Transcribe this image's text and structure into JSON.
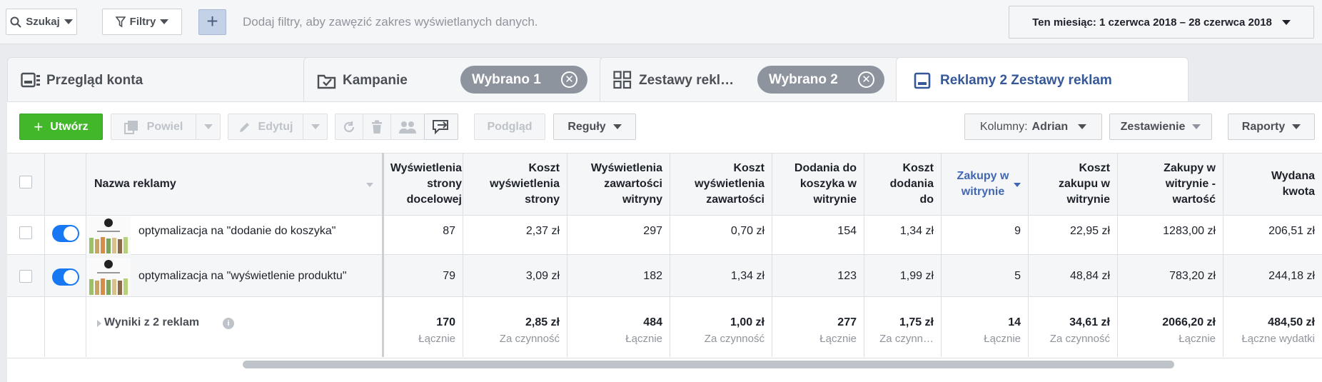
{
  "topbar": {
    "search_label": "Szukaj",
    "filters_label": "Filtry",
    "add_label": "+",
    "filter_hint": "Dodaj filtry, aby zawęzić zakres wyświetlanych danych.",
    "date_range": "Ten miesiąc: 1 czerwca 2018 – 28 czerwca 2018"
  },
  "tabs": [
    {
      "label": "Przegląd konta",
      "icon": "account-overview-icon"
    },
    {
      "label": "Kampanie",
      "icon": "folder-check-icon",
      "pill": "Wybrano 1"
    },
    {
      "label": "Zestawy rekl…",
      "icon": "grid-icon",
      "pill": "Wybrano 2"
    },
    {
      "label": "Reklamy 2 Zestawy reklam",
      "icon": "ad-icon",
      "active": true
    }
  ],
  "toolbar": {
    "create": "Utwórz",
    "duplicate": "Powiel",
    "edit": "Edytuj",
    "preview": "Podgląd",
    "rules": "Reguły",
    "columns_prefix": "Kolumny:",
    "columns_value": "Adrian",
    "breakdown": "Zestawienie",
    "reports": "Raporty"
  },
  "table": {
    "name_header": "Nazwa reklamy",
    "headers": [
      "Wyświetlenia strony docelowej",
      "Koszt wyświetlenia strony",
      "Wyświetlenia zawartości witryny",
      "Koszt wyświetlenia zawartości",
      "Dodania do koszyka w witrynie",
      "Koszt dodania do",
      "Zakupy w witrynie",
      "Koszt zakupu w witrynie",
      "Zakupy w witrynie - wartość",
      "Wydana kwota"
    ],
    "rows": [
      {
        "name": "optymalizacja na \"dodanie do koszyka\"",
        "active": true,
        "values": [
          "87",
          "2,37 zł",
          "297",
          "0,70 zł",
          "154",
          "1,34 zł",
          "9",
          "22,95 zł",
          "1283,00 zł",
          "206,51 zł"
        ]
      },
      {
        "name": "optymalizacja na \"wyświetlenie produktu\"",
        "active": true,
        "values": [
          "79",
          "3,09 zł",
          "182",
          "1,34 zł",
          "123",
          "1,99 zł",
          "5",
          "48,84 zł",
          "783,20 zł",
          "244,18 zł"
        ]
      }
    ],
    "totals": {
      "label": "Wyniki z 2 reklam",
      "values": [
        "170",
        "2,85 zł",
        "484",
        "1,00 zł",
        "277",
        "1,75 zł",
        "14",
        "34,61 zł",
        "2066,20 zł",
        "484,50 zł"
      ],
      "subs": [
        "Łącznie",
        "Za czynność",
        "Łącznie",
        "Za czynność",
        "Łącznie",
        "Za czynn…",
        "Łącznie",
        "Za czynność",
        "Łącznie",
        "Łączne wydatki"
      ]
    }
  },
  "colors": {
    "accent": "#42b72a",
    "link": "#4267b2",
    "toggle": "#1877f2"
  }
}
